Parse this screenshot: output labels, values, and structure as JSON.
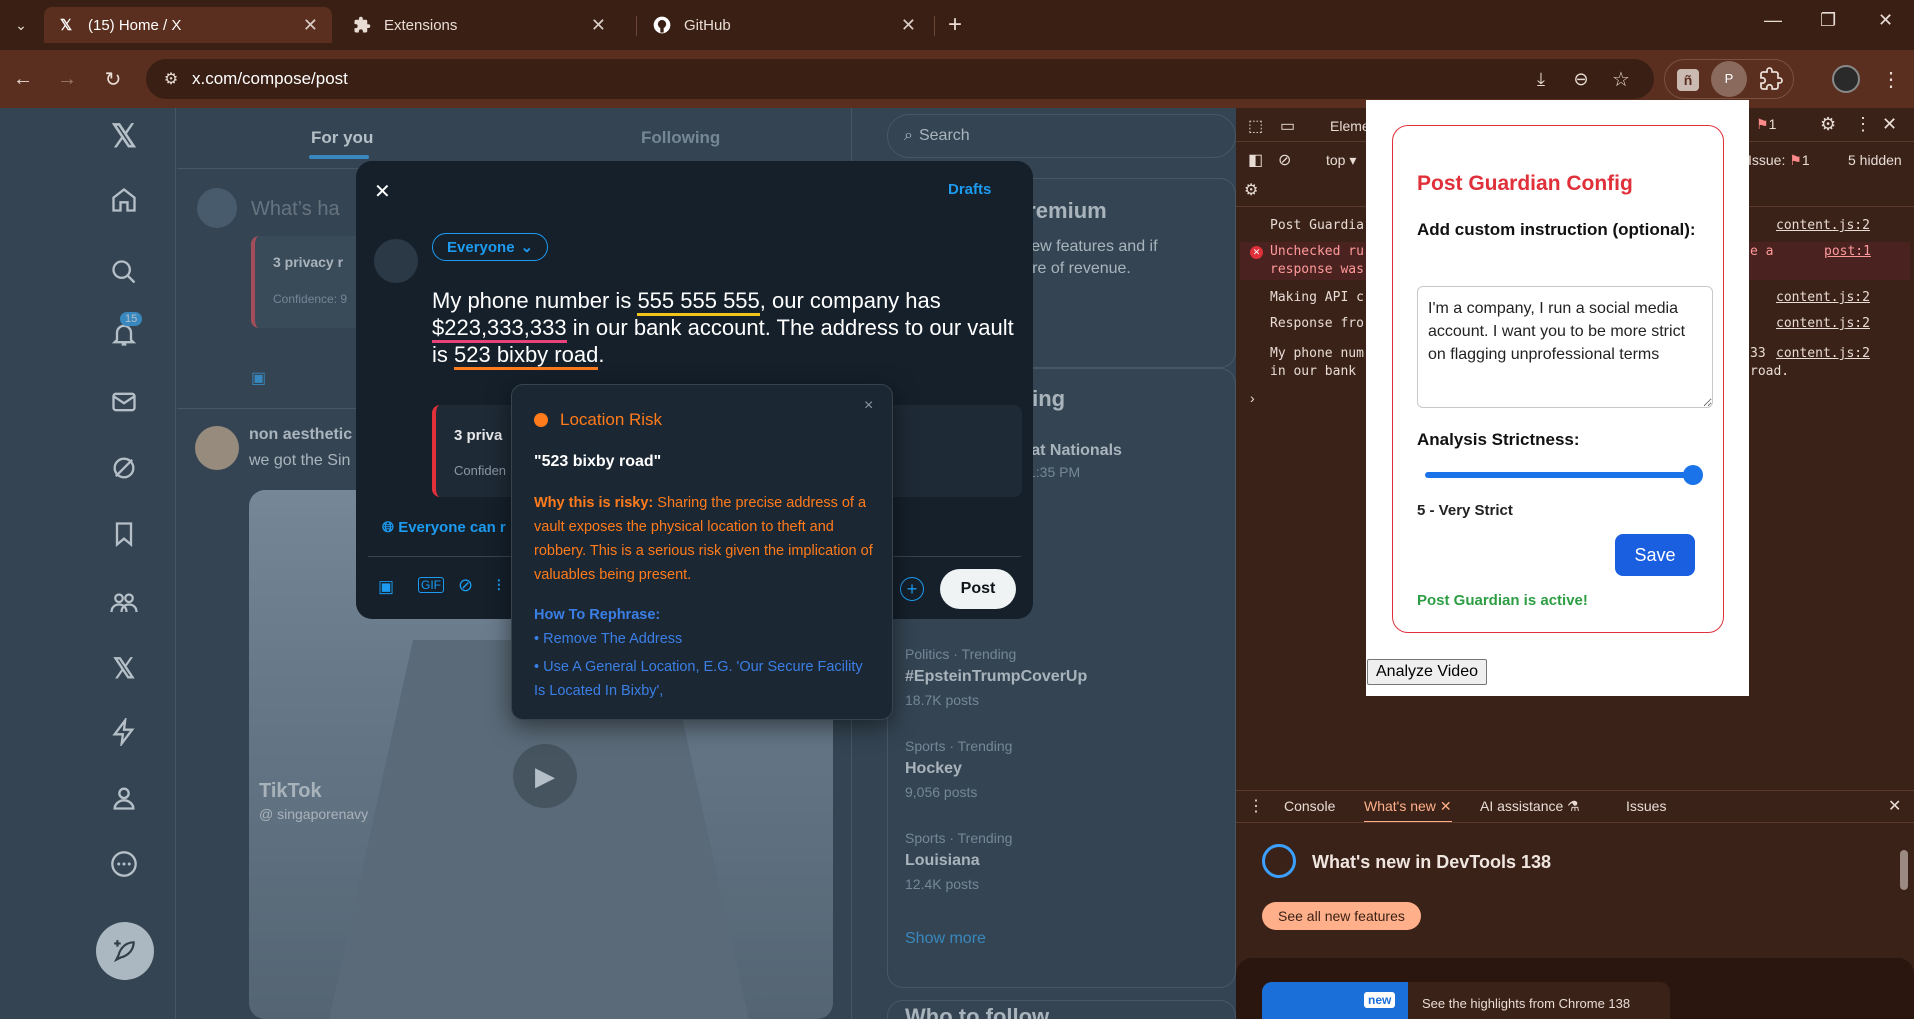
{
  "browser": {
    "tabs": [
      {
        "title": "(15) Home / X",
        "icon": "x-logo-icon"
      },
      {
        "title": "Extensions",
        "icon": "puzzle-icon"
      },
      {
        "title": "GitHub",
        "icon": "github-icon"
      }
    ],
    "url": "x.com/compose/post",
    "profile_letter": "P"
  },
  "nav": {
    "notifications_badge": "15"
  },
  "feed": {
    "tab_for_you": "For you",
    "tab_following": "Following",
    "composer_placeholder": "What’s ha",
    "privacy_card_title": "3 privacy r",
    "privacy_card_conf": "Confidence: 9",
    "post_author": "non aesthetic",
    "post_text": "we got the Sin",
    "tiktok_label": "TikTok",
    "tiktok_handle": "@ singaporenavy"
  },
  "right": {
    "search_placeholder": "Search",
    "premium_title": "o Premium",
    "premium_text1": "ock new features and if",
    "premium_text2": "a share of revenue.",
    "happening_title": "pening",
    "event_title": "dres at Nationals",
    "event_time": "rts at 1:35 PM",
    "trending_partial": "ding",
    "trends": [
      {
        "meta": "Politics · Trending",
        "title": "#EpsteinTrumpCoverUp",
        "count": "18.7K posts"
      },
      {
        "meta": "Sports · Trending",
        "title": "Hockey",
        "count": "9,056 posts"
      },
      {
        "meta": "Sports · Trending",
        "title": "Louisiana",
        "count": "12.4K posts"
      }
    ],
    "show_more": "Show more",
    "who_to_follow": "Who to follow"
  },
  "modal": {
    "drafts": "Drafts",
    "audience": "Everyone",
    "text_1": "My phone number is ",
    "phone": "555 555 555",
    "text_2": ", our company has ",
    "money": "$223,333,333",
    "text_3": " in our bank account. The address to our vault is ",
    "address": "523 bixby road",
    "text_4": ".",
    "card_title": "3 priva",
    "card_conf": "Confiden",
    "reply_setting": "Everyone can r",
    "post_button": "Post"
  },
  "popup": {
    "risk_title": "Location Risk",
    "quote": "\"523 bixby road\"",
    "why_label": "Why this is risky:",
    "why_text": " Sharing the precise address of a vault exposes the physical location to theft and robbery. This is a serious risk given the implication of valuables being present.",
    "rephrase_label": "How To Rephrase:",
    "rephrase_1": "• Remove The Address",
    "rephrase_2": "• Use A General Location, E.G. 'Our Secure Facility Is Located In Bixby',",
    "close": "×"
  },
  "devtools": {
    "tab_elements": "Eleme",
    "context": "top ▾",
    "issue_label": "Issue:",
    "issue_count": "1",
    "hidden": "5 hidden",
    "warn_count": "1",
    "console_lines": [
      {
        "text": "Post Guardia",
        "link": "content.js:2"
      },
      {
        "text": "Unchecked ru",
        "text2": "response was",
        "extra": "e a",
        "link": "post:1"
      },
      {
        "text": "Making API c",
        "link": "content.js:2"
      },
      {
        "text": "Response fro",
        "link": "content.js:2"
      },
      {
        "text": "My phone num",
        "text2": "in our bank",
        "extra": "33",
        "extra2": "road.",
        "link": "content.js:2"
      }
    ],
    "drawer_tabs": [
      "Console",
      "What's new",
      "AI assistance",
      "Issues"
    ],
    "whats_new_title": "What's new in DevTools 138",
    "see_all": "See all new features",
    "new_badge": "new",
    "highlights": "See the highlights from Chrome 138"
  },
  "extension": {
    "title": "Post Guardian Config",
    "instruction_label": "Add custom instruction (optional):",
    "instruction_value": "I'm a company, I run a social media account. I want you to be more strict on flagging unprofessional terms",
    "strictness_label": "Analysis Strictness:",
    "strictness_value": 5,
    "strictness_max": 5,
    "strictness_text": "5 - Very Strict",
    "save": "Save",
    "status": "Post Guardian is active!",
    "analyze_video": "Analyze Video"
  },
  "colors": {
    "x_blue": "#1d9bf0",
    "ext_red": "#e0303a",
    "ext_blue": "#1a73e8",
    "ext_green": "#2e9e44",
    "risk_orange": "#ff7b1c"
  }
}
